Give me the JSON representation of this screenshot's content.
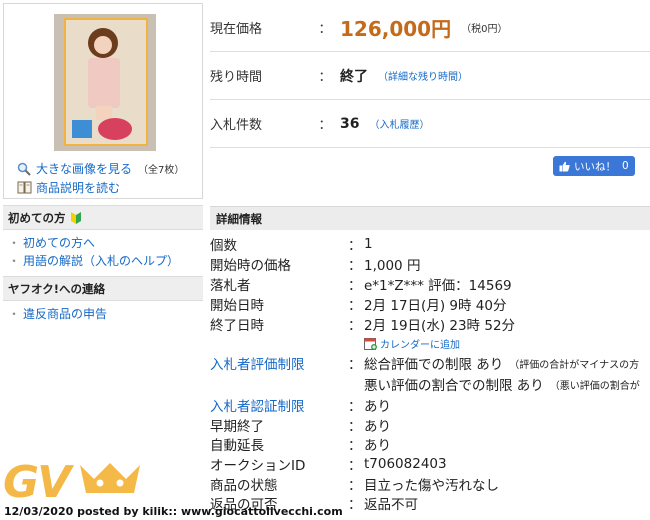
{
  "left": {
    "gallery": {
      "view_large": "大きな画像を見る",
      "image_count": "（全7枚）",
      "read_description": "商品説明を読む"
    },
    "beginner": {
      "heading": "初めての方",
      "items": [
        "初めての方へ",
        "用語の解説（入札のヘルプ）"
      ]
    },
    "contact": {
      "heading": "ヤフオク!への連絡",
      "items": [
        "違反商品の申告"
      ]
    }
  },
  "summary": {
    "price": {
      "label": "現在価格",
      "colon": "：",
      "value": "126,000円",
      "tax": "（税0円）"
    },
    "time_left": {
      "label": "残り時間",
      "colon": "：",
      "value": "終了",
      "link": "（詳細な残り時間）"
    },
    "bids": {
      "label": "入札件数",
      "colon": "：",
      "value": "36",
      "link": "（入札履歴）"
    }
  },
  "like": {
    "label": "いいね！",
    "count": "0"
  },
  "details": {
    "heading": "詳細情報",
    "rows": [
      {
        "key": "個数",
        "colon": "：",
        "value": "1"
      },
      {
        "key": "開始時の価格",
        "colon": "：",
        "value": "1,000 円"
      },
      {
        "key": "落札者",
        "colon": "：",
        "value": "e*1*Z*** 評価：14569"
      },
      {
        "key": "開始日時",
        "colon": "：",
        "value": "2月 17日(月) 9時 40分"
      },
      {
        "key": "終了日時",
        "colon": "：",
        "value": "2月 19日(水) 23時 52分"
      }
    ],
    "calendar": "カレンダーに追加",
    "bidder_rating": {
      "key": "入札者評価制限",
      "colon": "：",
      "line1": "総合評価での制限 あり",
      "line1_note": "（評価の合計がマイナスの方",
      "line2": "悪い評価の割合での制限 あり",
      "line2_note": "（悪い評価の割合が"
    },
    "rows2": [
      {
        "key": "入札者認証制限",
        "colon": "：",
        "value": "あり"
      },
      {
        "key": "早期終了",
        "colon": "：",
        "value": "あり"
      },
      {
        "key": "自動延長",
        "colon": "：",
        "value": "あり"
      },
      {
        "key": "オークションID",
        "colon": "：",
        "value": "t706082403"
      },
      {
        "key": "商品の状態",
        "colon": "：",
        "value": "目立った傷や汚れなし"
      },
      {
        "key": "返品の可否",
        "colon": "：",
        "value": "返品不可"
      }
    ]
  },
  "watermark": {
    "logo_text": "GV",
    "caption": "12/03/2020 posted by kilik:: www.giocattolivecchi.com"
  },
  "colors": {
    "price": "#c46a1b",
    "link": "#1569c7",
    "like_button": "#3b77d6",
    "logo": "#f3b336"
  }
}
